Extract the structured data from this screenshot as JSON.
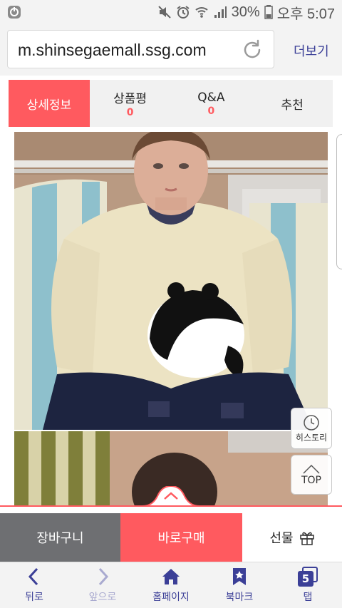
{
  "status": {
    "battery": "30%",
    "time": "오후 5:07"
  },
  "browser": {
    "url": "m.shinsegaemall.ssg.com",
    "more_label": "더보기"
  },
  "tabs": [
    {
      "label": "상세정보",
      "active": true
    },
    {
      "label": "상품평",
      "count": "0"
    },
    {
      "label": "Q&A",
      "count": "0"
    },
    {
      "label": "추천"
    }
  ],
  "floating": {
    "history_label": "히스토리",
    "top_label": "TOP"
  },
  "actions": {
    "cart": "장바구니",
    "buy": "바로구매",
    "gift": "선물"
  },
  "nav": {
    "back": "뒤로",
    "forward": "앞으로",
    "home": "홈페이지",
    "bookmark": "북마크",
    "tabs": "탭",
    "tab_count": "5"
  },
  "colors": {
    "accent": "#ff5a5f",
    "nav": "#3b3f97",
    "cart_bg": "#6e6f72"
  }
}
